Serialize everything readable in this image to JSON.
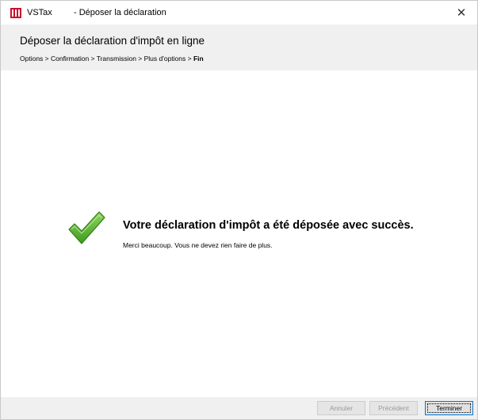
{
  "titlebar": {
    "app_name": "VSTax",
    "window_title": "- Déposer la déclaration",
    "close_glyph": "✕",
    "icon": "vstax-app-icon"
  },
  "header": {
    "title": "Déposer la déclaration d'impôt en ligne",
    "breadcrumb": {
      "steps": "Options > Confirmation > Transmission > Plus d'options > ",
      "current": "Fin"
    }
  },
  "content": {
    "icon": "checkmark-icon",
    "success_title": "Votre déclaration d'impôt a été déposée avec succès.",
    "success_message": "Merci beaucoup. Vous ne devez rien faire de plus."
  },
  "footer": {
    "cancel_label": "Annuler",
    "previous_label": "Précédent",
    "finish_label": "Terminer"
  },
  "colors": {
    "header_bg": "#f0f0f0",
    "check_green": "#5cb531",
    "app_icon_red": "#c8102e",
    "focus_blue": "#0078d7"
  }
}
